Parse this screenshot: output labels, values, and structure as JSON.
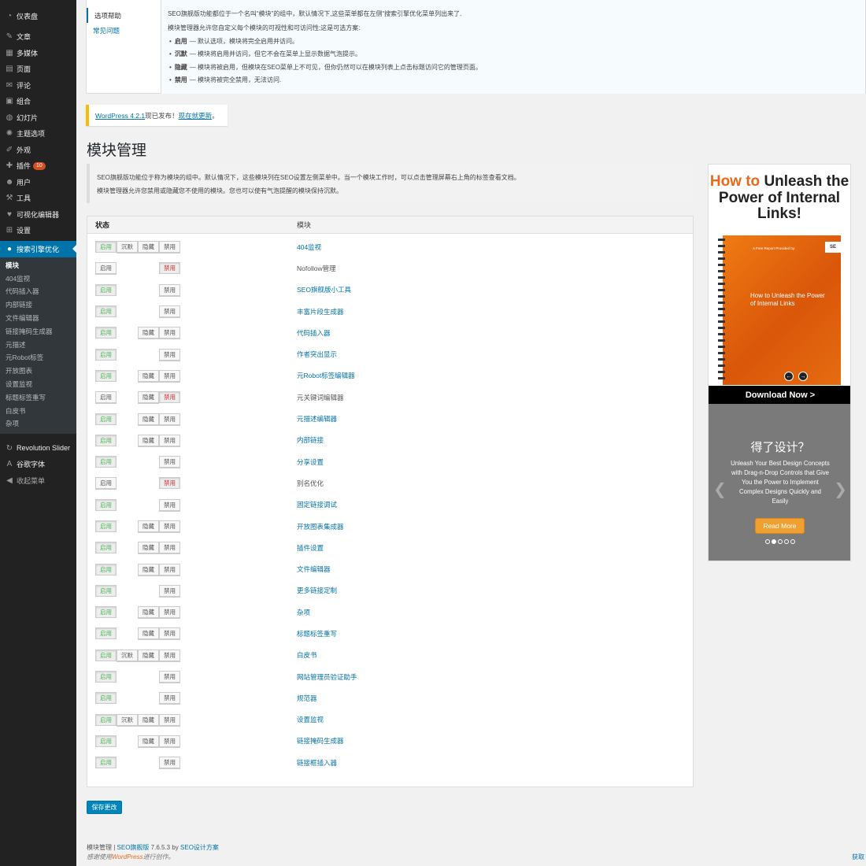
{
  "sidebar": {
    "top_items": [
      {
        "label": "仪表盘",
        "icon": "dashboard-icon",
        "glyph": "◔"
      },
      {
        "label": "文章",
        "icon": "pushpin-icon",
        "glyph": "✎"
      },
      {
        "label": "多媒体",
        "icon": "media-icon",
        "glyph": "▦"
      },
      {
        "label": "页面",
        "icon": "page-icon",
        "glyph": "▤"
      },
      {
        "label": "评论",
        "icon": "comment-icon",
        "glyph": "✉"
      },
      {
        "label": "组合",
        "icon": "portfolio-icon",
        "glyph": "▣"
      },
      {
        "label": "幻灯片",
        "icon": "slides-icon",
        "glyph": "◍"
      },
      {
        "label": "主题选项",
        "icon": "theme-options-icon",
        "glyph": "✺"
      },
      {
        "label": "外观",
        "icon": "appearance-icon",
        "glyph": "✐"
      },
      {
        "label": "插件",
        "icon": "plugin-icon",
        "glyph": "✚",
        "badge": "10"
      },
      {
        "label": "用户",
        "icon": "user-icon",
        "glyph": "☻"
      },
      {
        "label": "工具",
        "icon": "tools-icon",
        "glyph": "⚒"
      },
      {
        "label": "可视化编辑器",
        "icon": "visual-editor-icon",
        "glyph": "♥"
      },
      {
        "label": "设置",
        "icon": "settings-icon",
        "glyph": "⊞"
      }
    ],
    "active_item": {
      "label": "搜索引擎优化",
      "icon": "seo-icon",
      "glyph": "●"
    },
    "submenu": [
      "模块",
      "404监视",
      "代码插入器",
      "内部链接",
      "文件编辑器",
      "链接掩码生成器",
      "元描述",
      "元Robot标签",
      "开放图表",
      "设置监视",
      "标题标签重写",
      "白皮书",
      "杂项"
    ],
    "bottom_items": [
      {
        "label": "Revolution Slider",
        "icon": "refresh-icon",
        "glyph": "↻"
      },
      {
        "label": "谷歌字体",
        "icon": "font-icon",
        "glyph": "A"
      },
      {
        "label": "收起菜单",
        "icon": "collapse-icon",
        "glyph": "◀"
      }
    ]
  },
  "help": {
    "tabs": [
      "选项帮助",
      "常见问题"
    ],
    "p1": "SEO旗舰版功能都位于一个名叫“模块”的组中，默认情况下,这些菜单都在左侧“搜索引擎优化菜单列出来了.",
    "p2": "模块管理器允许您自定义每个模块的可视性和可访问性;这是可选方案:",
    "items": [
      {
        "term": "启用",
        "desc": "— 默认选项，模块将完全启用并访问。"
      },
      {
        "term": "沉默",
        "desc": "— 模块将启用并访问，但它不会在菜单上显示数据气泡提示。"
      },
      {
        "term": "隐藏",
        "desc": "— 模块将被启用，但模块在SEO菜单上不可见，但你仍然可以在模块列表上点击标题访问它的管理页面。"
      },
      {
        "term": "禁用",
        "desc": "— 模块将被完全禁用，无法访问."
      }
    ]
  },
  "notice": {
    "link1": "WordPress 4.2.1",
    "text": "现已发布！",
    "link2": "现在就更新",
    "end": "。"
  },
  "page_title": "模块管理",
  "intro": {
    "line1": "SEO旗舰版功能位于称为模块的组中。默认情况下，这些模块列在SEO设置左侧菜单中。当一个模块工作时，可以点击管理屏幕右上角的标签查看文档。",
    "line2": "模块管理器允许您禁用或隐藏您不使用的模块。您也可以使有气泡提醒的模块保持沉默。"
  },
  "table": {
    "col_status": "状态",
    "col_module": "模块",
    "btn_labels": {
      "enable": "启用",
      "silent": "沉默",
      "hide": "隐藏",
      "disable": "禁用"
    },
    "rows": [
      {
        "name": "404监视",
        "btns": [
          "enable",
          "silent",
          "hide",
          "disable"
        ],
        "sel": "enable",
        "link": true
      },
      {
        "name": "Nofollow管理",
        "btns": [
          "enable",
          "",
          "",
          "disable"
        ],
        "sel": "disable",
        "link": false
      },
      {
        "name": "SEO旗舰版小工具",
        "btns": [
          "enable",
          "",
          "",
          "disable"
        ],
        "sel": "enable",
        "link": true
      },
      {
        "name": "丰富片段生成器",
        "btns": [
          "enable",
          "",
          "",
          "disable"
        ],
        "sel": "enable",
        "link": true
      },
      {
        "name": "代码插入器",
        "btns": [
          "enable",
          "",
          "hide",
          "disable"
        ],
        "sel": "enable",
        "link": true
      },
      {
        "name": "作者突出显示",
        "btns": [
          "enable",
          "",
          "",
          "disable"
        ],
        "sel": "enable",
        "link": true
      },
      {
        "name": "元Robot标签编辑器",
        "btns": [
          "enable",
          "",
          "hide",
          "disable"
        ],
        "sel": "enable",
        "link": true
      },
      {
        "name": "元关键词编辑器",
        "btns": [
          "enable",
          "",
          "hide",
          "disable"
        ],
        "sel": "disable",
        "link": false
      },
      {
        "name": "元描述编辑器",
        "btns": [
          "enable",
          "",
          "hide",
          "disable"
        ],
        "sel": "enable",
        "link": true
      },
      {
        "name": "内部链接",
        "btns": [
          "enable",
          "",
          "hide",
          "disable"
        ],
        "sel": "enable",
        "link": true
      },
      {
        "name": "分享设置",
        "btns": [
          "enable",
          "",
          "",
          "disable"
        ],
        "sel": "enable",
        "link": true
      },
      {
        "name": "别名优化",
        "btns": [
          "enable",
          "",
          "",
          "disable"
        ],
        "sel": "disable",
        "link": false
      },
      {
        "name": "固定链接调试",
        "btns": [
          "enable",
          "",
          "",
          "disable"
        ],
        "sel": "enable",
        "link": true
      },
      {
        "name": "开放图表集成器",
        "btns": [
          "enable",
          "",
          "hide",
          "disable"
        ],
        "sel": "enable",
        "link": true
      },
      {
        "name": "插件设置",
        "btns": [
          "enable",
          "",
          "hide",
          "disable"
        ],
        "sel": "enable",
        "link": true
      },
      {
        "name": "文件编辑器",
        "btns": [
          "enable",
          "",
          "hide",
          "disable"
        ],
        "sel": "enable",
        "link": true
      },
      {
        "name": "更多链接定制",
        "btns": [
          "enable",
          "",
          "",
          "disable"
        ],
        "sel": "enable",
        "link": true
      },
      {
        "name": "杂项",
        "btns": [
          "enable",
          "",
          "hide",
          "disable"
        ],
        "sel": "enable",
        "link": true
      },
      {
        "name": "标题标签重写",
        "btns": [
          "enable",
          "",
          "hide",
          "disable"
        ],
        "sel": "enable",
        "link": true
      },
      {
        "name": "白皮书",
        "btns": [
          "enable",
          "silent",
          "hide",
          "disable"
        ],
        "sel": "enable",
        "link": true
      },
      {
        "name": "网站管理员验证助手",
        "btns": [
          "enable",
          "",
          "",
          "disable"
        ],
        "sel": "enable",
        "link": true
      },
      {
        "name": "规范器",
        "btns": [
          "enable",
          "",
          "",
          "disable"
        ],
        "sel": "enable",
        "link": true
      },
      {
        "name": "设置监视",
        "btns": [
          "enable",
          "silent",
          "hide",
          "disable"
        ],
        "sel": "enable",
        "link": true
      },
      {
        "name": "链接掩码生成器",
        "btns": [
          "enable",
          "",
          "hide",
          "disable"
        ],
        "sel": "enable",
        "link": true
      },
      {
        "name": "链接框插入器",
        "btns": [
          "enable",
          "",
          "",
          "disable"
        ],
        "sel": "enable",
        "link": true
      }
    ]
  },
  "ad": {
    "title_a": "How to",
    "title_b": " Unleash the Power of Internal Links!",
    "book_report": "A Free Report Provided by:",
    "book_logo": "SE",
    "book_text": "How to Unleash the Power of Internal Links",
    "prev": "←",
    "next": "→",
    "download": "Download Now >",
    "heading": "得了设计？",
    "desc": "Unleash Your Best Design Concepts with Drag-n-Drop Controls that Give You the Power to Implement Complex Designs Quickly and Easily",
    "arrow_l": "❮",
    "arrow_r": "❯",
    "read_more": "Read More",
    "dots": 5,
    "active_dot": 1
  },
  "save_label": "保存更改",
  "footer": {
    "line1_a": "模块管理 | ",
    "line1_link1": "SEO旗舰版",
    "line1_b": " 7.6.5.3 by ",
    "line1_link2": "SEO设计方案",
    "line2_a": "感谢使用",
    "line2_wp": "WordPress",
    "line2_b": "进行创作。",
    "right": "获取"
  },
  "colors": {
    "accent": "#0073aa",
    "enabled": "#46b450",
    "disabled": "#dc3232",
    "notice": "#ffba00",
    "brand_orange": "#e8691e"
  }
}
